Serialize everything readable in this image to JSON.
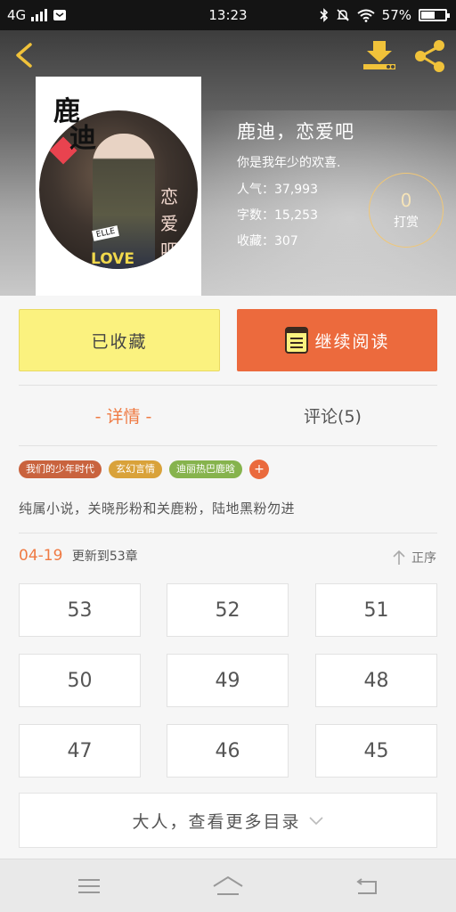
{
  "status_bar": {
    "network": "4G",
    "time": "13:23",
    "battery": "57%",
    "battery_level": 0.57,
    "icons": [
      "signal-icon",
      "message-icon",
      "bluetooth-icon",
      "mute-icon",
      "wifi-icon",
      "battery-icon"
    ]
  },
  "header": {
    "icons": [
      "back-arrow-icon",
      "download-icon",
      "share-icon"
    ],
    "accent_color": "#f0c23a"
  },
  "book": {
    "title": "鹿迪，恋爱吧",
    "subtitle": "你是我年少的欢喜.",
    "popularity": "人气：37,993",
    "word_count": "字数：15,253",
    "favorites": "收藏：307",
    "tip_count": "0",
    "tip_label": "打赏"
  },
  "cover": {
    "title_char_1": "鹿",
    "title_char_2": "迪",
    "side_text": "恋爱吧",
    "badge": "ELLE",
    "love": "LOVE"
  },
  "actions": {
    "collected_label": "已收藏",
    "continue_label": "继续阅读",
    "collect_color": "#fbf27f",
    "continue_color": "#ec6a3d"
  },
  "tabs": {
    "detail": "- 详情 -",
    "comments": "评论(5)",
    "active_color": "#ef7a43"
  },
  "tags": [
    {
      "label": "我们的少年时代",
      "color": "#c9633e"
    },
    {
      "label": "玄幻言情",
      "color": "#d9a23a"
    },
    {
      "label": "迪丽热巴鹿晗",
      "color": "#86b34d"
    }
  ],
  "tag_add": "+",
  "description": "纯属小说，关晓彤粉和关鹿粉，陆地黑粉勿进",
  "update": {
    "date": "04-19",
    "text": "更新到53章",
    "sort_label": "正序"
  },
  "chapters": [
    "53",
    "52",
    "51",
    "50",
    "49",
    "48",
    "47",
    "46",
    "45"
  ],
  "more_label": "大人，查看更多目录",
  "navbar_icons": [
    "menu-icon",
    "home-icon",
    "back-icon"
  ]
}
